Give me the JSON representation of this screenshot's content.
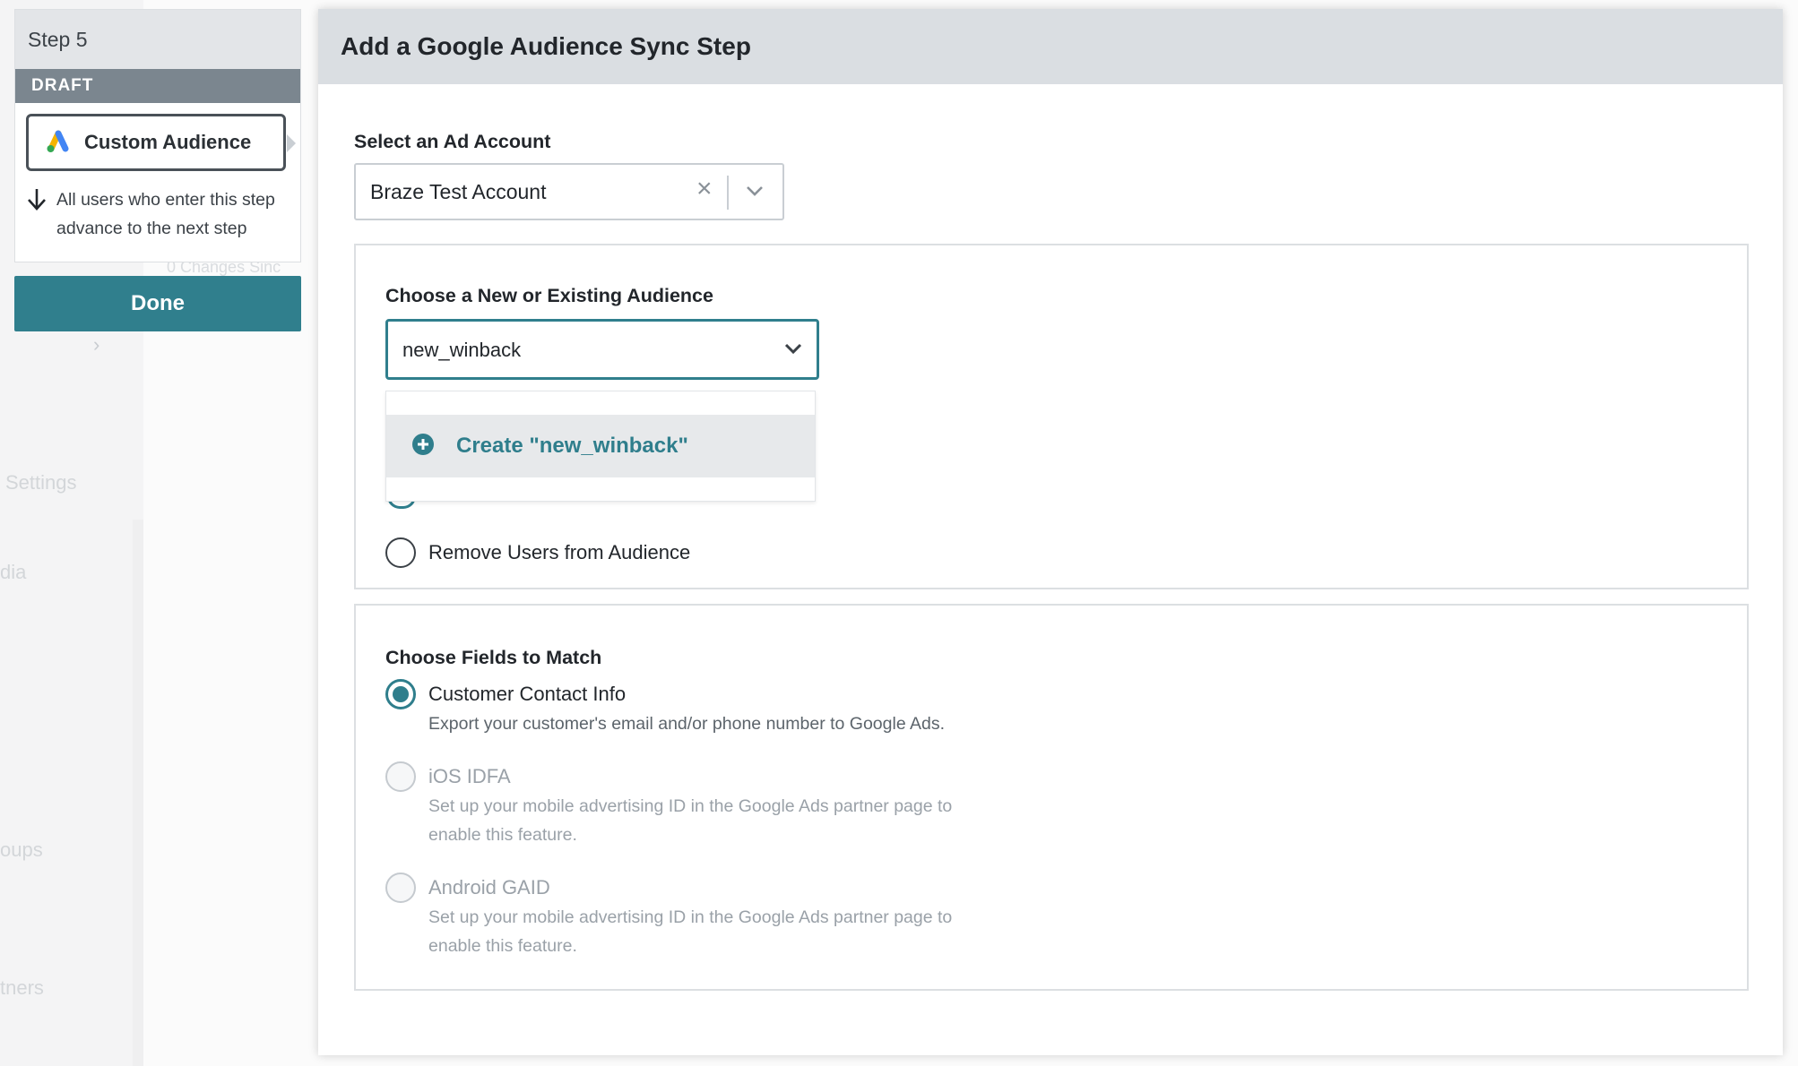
{
  "background": {
    "ghost_texts": [
      "Settings",
      "dia",
      "oups",
      "tners"
    ],
    "ghost_small": "0 Changes Sinc"
  },
  "step_card": {
    "step_label": "Step 5",
    "status_label": "DRAFT",
    "audience_label": "Custom Audience",
    "advance_text": "All users who enter this step advance to the next step"
  },
  "done_label": "Done",
  "modal": {
    "title": "Add a Google Audience Sync Step",
    "ad_account": {
      "label": "Select an Ad Account",
      "value": "Braze Test Account"
    },
    "audience": {
      "label": "Choose a New or Existing Audience",
      "value": "new_winback",
      "create_option": "Create \"new_winback\"",
      "remove_option": "Remove Users from Audience"
    },
    "fields": {
      "label": "Choose Fields to Match",
      "options": [
        {
          "title": "Customer Contact Info",
          "description": "Export your customer's email and/or phone number to Google Ads.",
          "checked": true,
          "disabled": false
        },
        {
          "title": "iOS IDFA",
          "description": "Set up your mobile advertising ID in the Google Ads partner page to enable this feature.",
          "checked": false,
          "disabled": true
        },
        {
          "title": "Android GAID",
          "description": "Set up your mobile advertising ID in the Google Ads partner page to enable this feature.",
          "checked": false,
          "disabled": true
        }
      ]
    }
  },
  "colors": {
    "accent": "#307f8d",
    "header_bg": "#dadee2",
    "draft_bar": "#7b868f"
  }
}
